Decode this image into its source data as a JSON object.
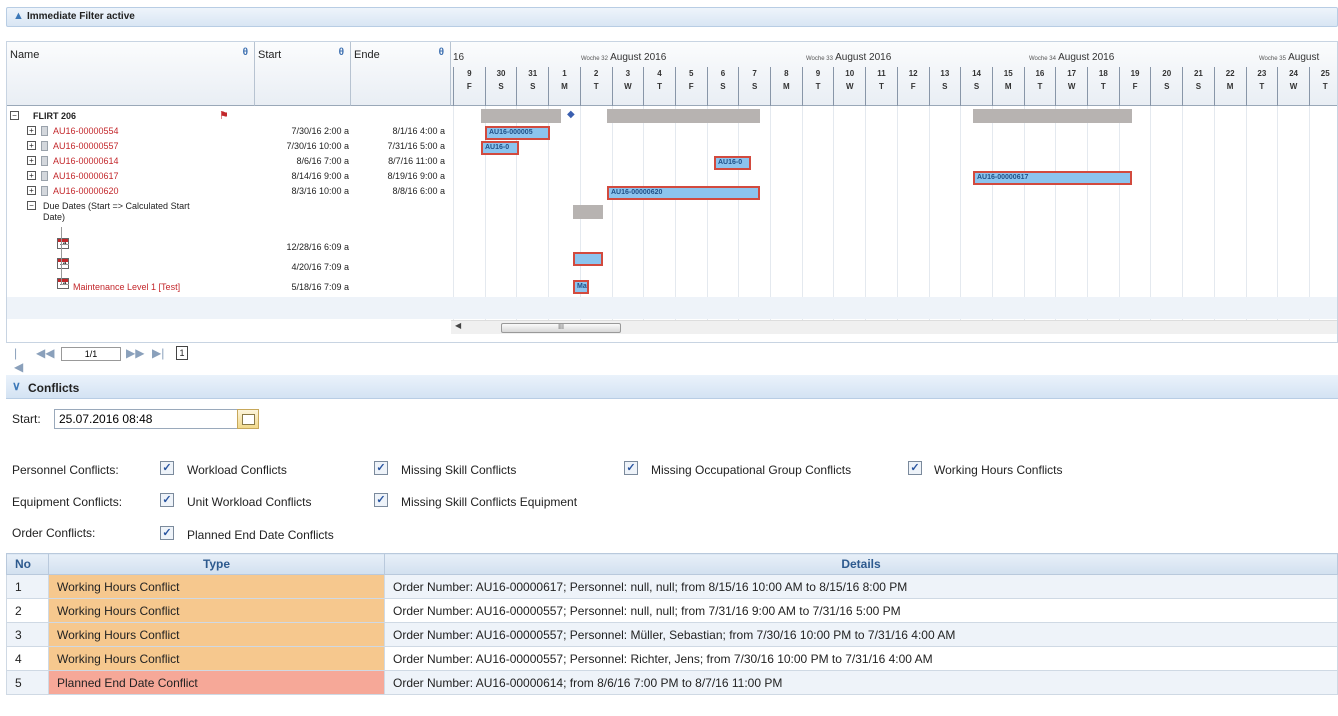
{
  "filter_bar": {
    "label": "Immediate Filter active"
  },
  "gantt": {
    "columns": {
      "name": "Name",
      "start": "Start",
      "end": "Ende"
    },
    "year_fragment": "16",
    "weeks": [
      {
        "prefix": "Woche 32",
        "title": "August 2016"
      },
      {
        "prefix": "Woche 33",
        "title": "August 2016"
      },
      {
        "prefix": "Woche 34",
        "title": "August 2016"
      },
      {
        "prefix": "Woche 35",
        "title": "August"
      }
    ],
    "days": [
      {
        "n": "9",
        "d": "F"
      },
      {
        "n": "30",
        "d": "S"
      },
      {
        "n": "31",
        "d": "S"
      },
      {
        "n": "1",
        "d": "M"
      },
      {
        "n": "2",
        "d": "T"
      },
      {
        "n": "3",
        "d": "W"
      },
      {
        "n": "4",
        "d": "T"
      },
      {
        "n": "5",
        "d": "F"
      },
      {
        "n": "6",
        "d": "S"
      },
      {
        "n": "7",
        "d": "S"
      },
      {
        "n": "8",
        "d": "M"
      },
      {
        "n": "9",
        "d": "T"
      },
      {
        "n": "10",
        "d": "W"
      },
      {
        "n": "11",
        "d": "T"
      },
      {
        "n": "12",
        "d": "F"
      },
      {
        "n": "13",
        "d": "S"
      },
      {
        "n": "14",
        "d": "S"
      },
      {
        "n": "15",
        "d": "M"
      },
      {
        "n": "16",
        "d": "T"
      },
      {
        "n": "17",
        "d": "W"
      },
      {
        "n": "18",
        "d": "T"
      },
      {
        "n": "19",
        "d": "F"
      },
      {
        "n": "20",
        "d": "S"
      },
      {
        "n": "21",
        "d": "S"
      },
      {
        "n": "22",
        "d": "M"
      },
      {
        "n": "23",
        "d": "T"
      },
      {
        "n": "24",
        "d": "W"
      },
      {
        "n": "25",
        "d": "T"
      }
    ],
    "rows": [
      {
        "name": "FLIRT 206",
        "start": "",
        "end": ""
      },
      {
        "name": "AU16-00000554",
        "start": "7/30/16 2:00 a",
        "end": "8/1/16 4:00 a"
      },
      {
        "name": "AU16-00000557",
        "start": "7/30/16 10:00 a",
        "end": "7/31/16 5:00 a"
      },
      {
        "name": "AU16-00000614",
        "start": "8/6/16 7:00 a",
        "end": "8/7/16 11:00 a"
      },
      {
        "name": "AU16-00000617",
        "start": "8/14/16 9:00 a",
        "end": "8/19/16 9:00 a"
      },
      {
        "name": "AU16-00000620",
        "start": "8/3/16 10:00 a",
        "end": "8/8/16 6:00 a"
      },
      {
        "name": "Due Dates (Start => Calculated Start",
        "name2": "Date)",
        "start": "",
        "end": ""
      },
      {
        "name": "",
        "start": "12/28/16 6:09 a",
        "end": ""
      },
      {
        "name": "",
        "start": "4/20/16 7:09 a",
        "end": ""
      },
      {
        "name": "Maintenance Level 1 [Test]",
        "start": "5/18/16 7:09 a",
        "end": ""
      }
    ],
    "cal_icon_text": "14",
    "bars": {
      "b554": "AU16-000005",
      "b557": "AU16-0",
      "b614": "AU16-0",
      "b617": "AU16-00000617",
      "b620": "AU16-00000620",
      "bml": "Ma"
    },
    "scroll_thumb": "III"
  },
  "pager": {
    "page": "1/1",
    "page_icon": "1"
  },
  "conflicts": {
    "title": "Conflicts",
    "start_label": "Start:",
    "start_value": "25.07.2016 08:48",
    "personnel_label": "Personnel Conflicts:",
    "equipment_label": "Equipment Conflicts:",
    "order_label": "Order Conflicts:",
    "personnel_opts": [
      "Workload Conflicts",
      "Missing Skill Conflicts",
      "Missing Occupational Group Conflicts",
      "Working Hours Conflicts"
    ],
    "equipment_opts": [
      "Unit Workload Conflicts",
      "Missing Skill Conflicts Equipment"
    ],
    "order_opts": [
      "Planned End Date Conflicts"
    ],
    "check_glyph": "✓",
    "table": {
      "headers": {
        "no": "No",
        "type": "Type",
        "details": "Details"
      },
      "rows": [
        {
          "no": "1",
          "type": "Working Hours Conflict",
          "details": "Order Number: AU16-00000617; Personnel: null, null; from 8/15/16 10:00 AM to 8/15/16 8:00 PM"
        },
        {
          "no": "2",
          "type": "Working Hours Conflict",
          "details": "Order Number: AU16-00000557; Personnel: null, null; from 7/31/16 9:00 AM to 7/31/16 5:00 PM"
        },
        {
          "no": "3",
          "type": "Working Hours Conflict",
          "details": "Order Number: AU16-00000557; Personnel: Müller, Sebastian; from 7/30/16 10:00 PM to 7/31/16 4:00 AM"
        },
        {
          "no": "4",
          "type": "Working Hours Conflict",
          "details": "Order Number: AU16-00000557; Personnel: Richter, Jens; from 7/30/16 10:00 PM to 7/31/16 4:00 AM"
        },
        {
          "no": "5",
          "type": "Planned End Date Conflict",
          "details": "Order Number: AU16-00000614; from 8/6/16 7:00 PM to 8/7/16 11:00 PM"
        }
      ]
    }
  }
}
